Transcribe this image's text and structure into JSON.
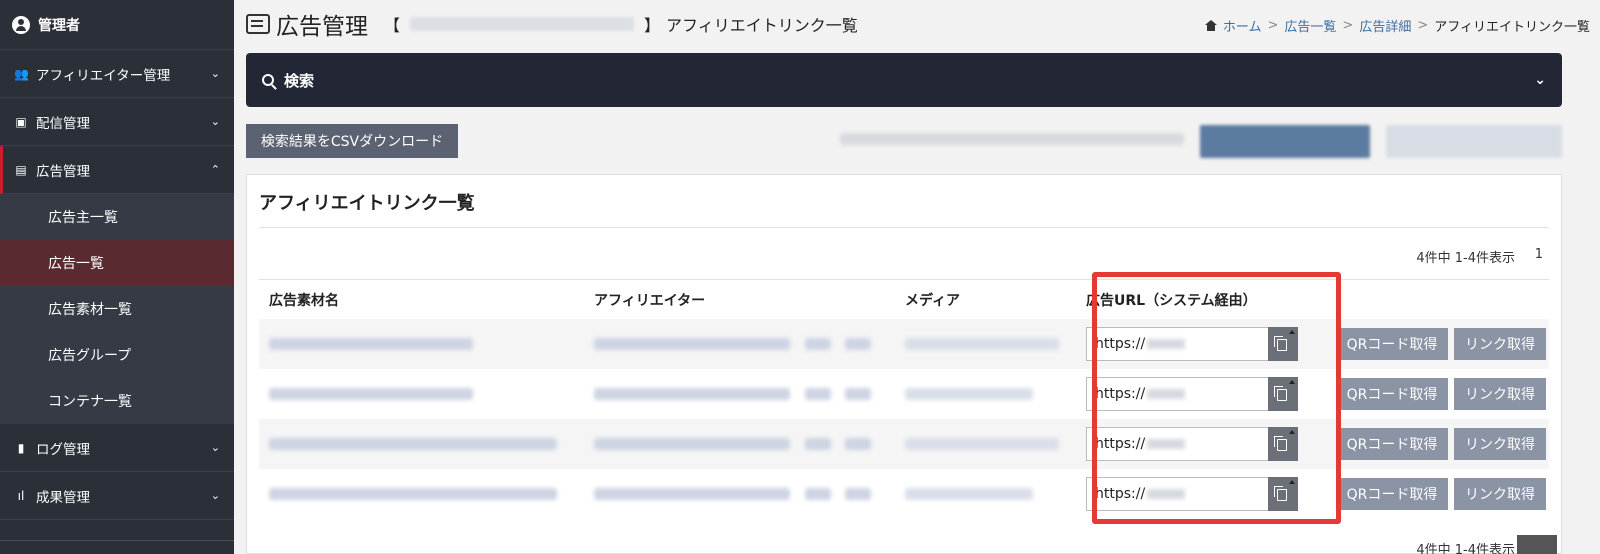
{
  "sidebar": {
    "user": "管理者",
    "items": [
      {
        "label": "アフィリエイター管理",
        "icon": "users-icon",
        "chevron": "⌄"
      },
      {
        "label": "配信管理",
        "icon": "delivery-icon",
        "chevron": "⌄"
      },
      {
        "label": "広告管理",
        "icon": "ad-icon",
        "chevron": "⌃"
      }
    ],
    "sub_items": [
      {
        "label": "広告主一覧"
      },
      {
        "label": "広告一覧"
      },
      {
        "label": "広告素材一覧"
      },
      {
        "label": "広告グループ"
      },
      {
        "label": "コンテナ一覧"
      }
    ],
    "items_after": [
      {
        "label": "ログ管理",
        "icon": "file-icon",
        "chevron": "⌄"
      },
      {
        "label": "成果管理",
        "icon": "chart-icon",
        "chevron": "⌄"
      }
    ]
  },
  "header": {
    "title": "広告管理",
    "bracket_open": "【",
    "bracket_close": "】",
    "subtitle": "アフィリエイトリンク一覧"
  },
  "breadcrumb": {
    "home": "ホーム",
    "sep": ">",
    "ad_list": "広告一覧",
    "ad_detail": "広告詳細",
    "current": "アフィリエイトリンク一覧"
  },
  "search": {
    "label": "検索"
  },
  "toolbar": {
    "csv_button": "検索結果をCSVダウンロード"
  },
  "panel": {
    "title": "アフィリエイトリンク一覧",
    "count": "4件中 1-4件表示",
    "page": "1",
    "count_bottom": "4件中 1-4件表示"
  },
  "table": {
    "headers": [
      "広告素材名",
      "アフィリエイター",
      "メディア",
      "広告URL（システム経由）"
    ],
    "rows": [
      {
        "url": "https://"
      },
      {
        "url": "https://"
      },
      {
        "url": "https://"
      },
      {
        "url": "https://"
      }
    ],
    "qr_label": "QRコード取得",
    "link_label": "リンク取得"
  },
  "colors": {
    "sidebar_bg": "#2b2f38",
    "search_bar_bg": "#232634",
    "highlight": "#e53935",
    "action_button": "#8a94a5"
  }
}
